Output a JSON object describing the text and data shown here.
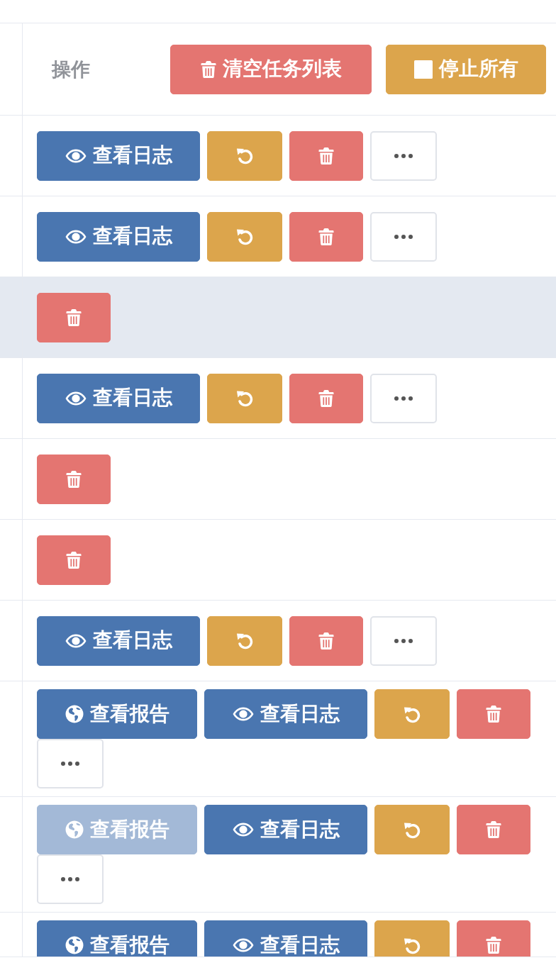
{
  "table": {
    "header": {
      "label": "操作",
      "buttons": [
        {
          "kind": "clear",
          "label": "清空任务列表",
          "disabled": false
        },
        {
          "kind": "stop",
          "label": "停止所有",
          "disabled": false
        }
      ]
    },
    "rows": [
      {
        "highlighted": false,
        "actions": [
          {
            "kind": "log",
            "label": "查看日志",
            "disabled": false
          },
          {
            "kind": "restart",
            "disabled": false
          },
          {
            "kind": "delete",
            "disabled": false
          },
          {
            "kind": "more",
            "disabled": false
          }
        ]
      },
      {
        "highlighted": false,
        "actions": [
          {
            "kind": "log",
            "label": "查看日志",
            "disabled": false
          },
          {
            "kind": "restart",
            "disabled": false
          },
          {
            "kind": "delete",
            "disabled": false
          },
          {
            "kind": "more",
            "disabled": false
          }
        ]
      },
      {
        "highlighted": true,
        "actions": [
          {
            "kind": "delete",
            "disabled": false
          }
        ]
      },
      {
        "highlighted": false,
        "actions": [
          {
            "kind": "log",
            "label": "查看日志",
            "disabled": false
          },
          {
            "kind": "restart",
            "disabled": false
          },
          {
            "kind": "delete",
            "disabled": false
          },
          {
            "kind": "more",
            "disabled": false
          }
        ]
      },
      {
        "highlighted": false,
        "actions": [
          {
            "kind": "delete",
            "disabled": false
          }
        ]
      },
      {
        "highlighted": false,
        "actions": [
          {
            "kind": "delete",
            "disabled": false
          }
        ]
      },
      {
        "highlighted": false,
        "actions": [
          {
            "kind": "log",
            "label": "查看日志",
            "disabled": false
          },
          {
            "kind": "restart",
            "disabled": false
          },
          {
            "kind": "delete",
            "disabled": false
          },
          {
            "kind": "more",
            "disabled": false
          }
        ]
      },
      {
        "highlighted": false,
        "actions": [
          {
            "kind": "report",
            "label": "查看报告",
            "disabled": false
          },
          {
            "kind": "log",
            "label": "查看日志",
            "disabled": false
          },
          {
            "kind": "restart",
            "disabled": false
          },
          {
            "kind": "delete",
            "disabled": false
          },
          {
            "kind": "more",
            "disabled": false
          }
        ]
      },
      {
        "highlighted": false,
        "actions": [
          {
            "kind": "report",
            "label": "查看报告",
            "disabled": true
          },
          {
            "kind": "log",
            "label": "查看日志",
            "disabled": false
          },
          {
            "kind": "restart",
            "disabled": false
          },
          {
            "kind": "delete",
            "disabled": false
          },
          {
            "kind": "more",
            "disabled": false
          }
        ]
      },
      {
        "highlighted": false,
        "actions": [
          {
            "kind": "report",
            "label": "查看报告",
            "disabled": false
          },
          {
            "kind": "log",
            "label": "查看日志",
            "disabled": false
          },
          {
            "kind": "restart",
            "disabled": false
          },
          {
            "kind": "delete",
            "disabled": false
          }
        ]
      }
    ]
  }
}
